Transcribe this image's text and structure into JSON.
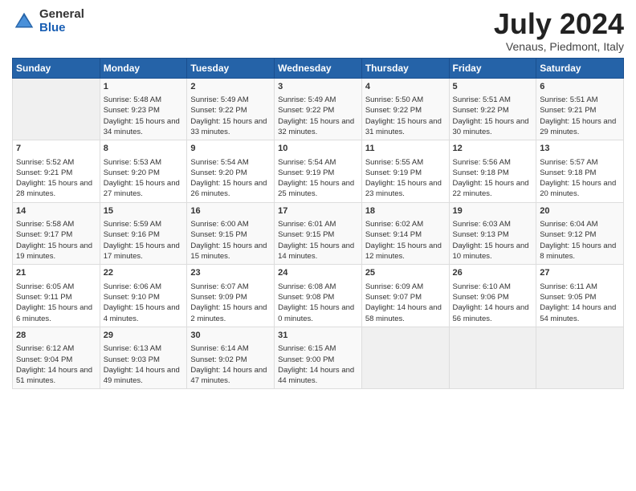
{
  "header": {
    "logo_general": "General",
    "logo_blue": "Blue",
    "month": "July 2024",
    "location": "Venaus, Piedmont, Italy"
  },
  "weekdays": [
    "Sunday",
    "Monday",
    "Tuesday",
    "Wednesday",
    "Thursday",
    "Friday",
    "Saturday"
  ],
  "weeks": [
    [
      {
        "day": "",
        "empty": true
      },
      {
        "day": "1",
        "sunrise": "Sunrise: 5:48 AM",
        "sunset": "Sunset: 9:23 PM",
        "daylight": "Daylight: 15 hours and 34 minutes."
      },
      {
        "day": "2",
        "sunrise": "Sunrise: 5:49 AM",
        "sunset": "Sunset: 9:22 PM",
        "daylight": "Daylight: 15 hours and 33 minutes."
      },
      {
        "day": "3",
        "sunrise": "Sunrise: 5:49 AM",
        "sunset": "Sunset: 9:22 PM",
        "daylight": "Daylight: 15 hours and 32 minutes."
      },
      {
        "day": "4",
        "sunrise": "Sunrise: 5:50 AM",
        "sunset": "Sunset: 9:22 PM",
        "daylight": "Daylight: 15 hours and 31 minutes."
      },
      {
        "day": "5",
        "sunrise": "Sunrise: 5:51 AM",
        "sunset": "Sunset: 9:22 PM",
        "daylight": "Daylight: 15 hours and 30 minutes."
      },
      {
        "day": "6",
        "sunrise": "Sunrise: 5:51 AM",
        "sunset": "Sunset: 9:21 PM",
        "daylight": "Daylight: 15 hours and 29 minutes."
      }
    ],
    [
      {
        "day": "7",
        "sunrise": "Sunrise: 5:52 AM",
        "sunset": "Sunset: 9:21 PM",
        "daylight": "Daylight: 15 hours and 28 minutes."
      },
      {
        "day": "8",
        "sunrise": "Sunrise: 5:53 AM",
        "sunset": "Sunset: 9:20 PM",
        "daylight": "Daylight: 15 hours and 27 minutes."
      },
      {
        "day": "9",
        "sunrise": "Sunrise: 5:54 AM",
        "sunset": "Sunset: 9:20 PM",
        "daylight": "Daylight: 15 hours and 26 minutes."
      },
      {
        "day": "10",
        "sunrise": "Sunrise: 5:54 AM",
        "sunset": "Sunset: 9:19 PM",
        "daylight": "Daylight: 15 hours and 25 minutes."
      },
      {
        "day": "11",
        "sunrise": "Sunrise: 5:55 AM",
        "sunset": "Sunset: 9:19 PM",
        "daylight": "Daylight: 15 hours and 23 minutes."
      },
      {
        "day": "12",
        "sunrise": "Sunrise: 5:56 AM",
        "sunset": "Sunset: 9:18 PM",
        "daylight": "Daylight: 15 hours and 22 minutes."
      },
      {
        "day": "13",
        "sunrise": "Sunrise: 5:57 AM",
        "sunset": "Sunset: 9:18 PM",
        "daylight": "Daylight: 15 hours and 20 minutes."
      }
    ],
    [
      {
        "day": "14",
        "sunrise": "Sunrise: 5:58 AM",
        "sunset": "Sunset: 9:17 PM",
        "daylight": "Daylight: 15 hours and 19 minutes."
      },
      {
        "day": "15",
        "sunrise": "Sunrise: 5:59 AM",
        "sunset": "Sunset: 9:16 PM",
        "daylight": "Daylight: 15 hours and 17 minutes."
      },
      {
        "day": "16",
        "sunrise": "Sunrise: 6:00 AM",
        "sunset": "Sunset: 9:15 PM",
        "daylight": "Daylight: 15 hours and 15 minutes."
      },
      {
        "day": "17",
        "sunrise": "Sunrise: 6:01 AM",
        "sunset": "Sunset: 9:15 PM",
        "daylight": "Daylight: 15 hours and 14 minutes."
      },
      {
        "day": "18",
        "sunrise": "Sunrise: 6:02 AM",
        "sunset": "Sunset: 9:14 PM",
        "daylight": "Daylight: 15 hours and 12 minutes."
      },
      {
        "day": "19",
        "sunrise": "Sunrise: 6:03 AM",
        "sunset": "Sunset: 9:13 PM",
        "daylight": "Daylight: 15 hours and 10 minutes."
      },
      {
        "day": "20",
        "sunrise": "Sunrise: 6:04 AM",
        "sunset": "Sunset: 9:12 PM",
        "daylight": "Daylight: 15 hours and 8 minutes."
      }
    ],
    [
      {
        "day": "21",
        "sunrise": "Sunrise: 6:05 AM",
        "sunset": "Sunset: 9:11 PM",
        "daylight": "Daylight: 15 hours and 6 minutes."
      },
      {
        "day": "22",
        "sunrise": "Sunrise: 6:06 AM",
        "sunset": "Sunset: 9:10 PM",
        "daylight": "Daylight: 15 hours and 4 minutes."
      },
      {
        "day": "23",
        "sunrise": "Sunrise: 6:07 AM",
        "sunset": "Sunset: 9:09 PM",
        "daylight": "Daylight: 15 hours and 2 minutes."
      },
      {
        "day": "24",
        "sunrise": "Sunrise: 6:08 AM",
        "sunset": "Sunset: 9:08 PM",
        "daylight": "Daylight: 15 hours and 0 minutes."
      },
      {
        "day": "25",
        "sunrise": "Sunrise: 6:09 AM",
        "sunset": "Sunset: 9:07 PM",
        "daylight": "Daylight: 14 hours and 58 minutes."
      },
      {
        "day": "26",
        "sunrise": "Sunrise: 6:10 AM",
        "sunset": "Sunset: 9:06 PM",
        "daylight": "Daylight: 14 hours and 56 minutes."
      },
      {
        "day": "27",
        "sunrise": "Sunrise: 6:11 AM",
        "sunset": "Sunset: 9:05 PM",
        "daylight": "Daylight: 14 hours and 54 minutes."
      }
    ],
    [
      {
        "day": "28",
        "sunrise": "Sunrise: 6:12 AM",
        "sunset": "Sunset: 9:04 PM",
        "daylight": "Daylight: 14 hours and 51 minutes."
      },
      {
        "day": "29",
        "sunrise": "Sunrise: 6:13 AM",
        "sunset": "Sunset: 9:03 PM",
        "daylight": "Daylight: 14 hours and 49 minutes."
      },
      {
        "day": "30",
        "sunrise": "Sunrise: 6:14 AM",
        "sunset": "Sunset: 9:02 PM",
        "daylight": "Daylight: 14 hours and 47 minutes."
      },
      {
        "day": "31",
        "sunrise": "Sunrise: 6:15 AM",
        "sunset": "Sunset: 9:00 PM",
        "daylight": "Daylight: 14 hours and 44 minutes."
      },
      {
        "day": "",
        "empty": true
      },
      {
        "day": "",
        "empty": true
      },
      {
        "day": "",
        "empty": true
      }
    ]
  ]
}
